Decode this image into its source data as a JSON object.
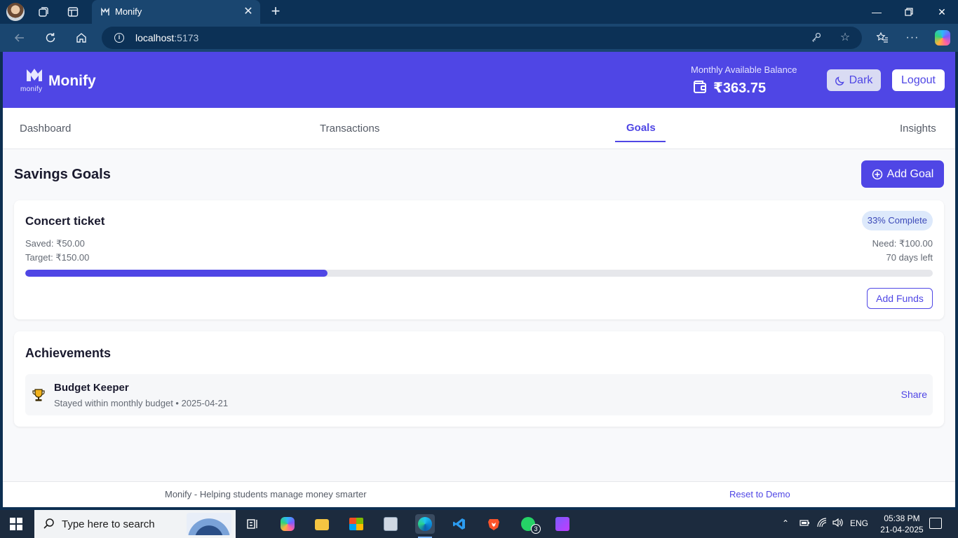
{
  "browser": {
    "tab_title": "Monify",
    "url_host": "localhost",
    "url_port": ":5173"
  },
  "header": {
    "logo_small": "monify",
    "brand": "Monify",
    "balance_label": "Monthly Available Balance",
    "balance_amount": "₹363.75",
    "theme_button": "Dark",
    "logout_button": "Logout"
  },
  "nav": {
    "tabs": [
      "Dashboard",
      "Transactions",
      "Goals",
      "Insights"
    ],
    "active": "Goals"
  },
  "page": {
    "title": "Savings Goals",
    "add_goal_button": "Add Goal"
  },
  "goal": {
    "name": "Concert ticket",
    "badge": "33% Complete",
    "saved": "Saved: ₹50.00",
    "target": "Target: ₹150.00",
    "need": "Need: ₹100.00",
    "days_left": "70 days left",
    "progress": 0.333,
    "add_funds_button": "Add Funds"
  },
  "achievements": {
    "title": "Achievements",
    "items": [
      {
        "icon": "trophy-icon",
        "name": "Budget Keeper",
        "description": "Stayed within monthly budget • 2025-04-21",
        "share_label": "Share"
      }
    ]
  },
  "footer": {
    "tagline": "Monify - Helping students manage money smarter",
    "reset_link": "Reset to Demo"
  },
  "taskbar": {
    "search_placeholder": "Type here to search",
    "lang": "ENG",
    "time": "05:38 PM",
    "date": "21-04-2025",
    "whatsapp_badge": "3"
  },
  "colors": {
    "accent": "#4f46e5",
    "browser_frame": "#0c3156",
    "page_background": "#f8f9fb"
  }
}
